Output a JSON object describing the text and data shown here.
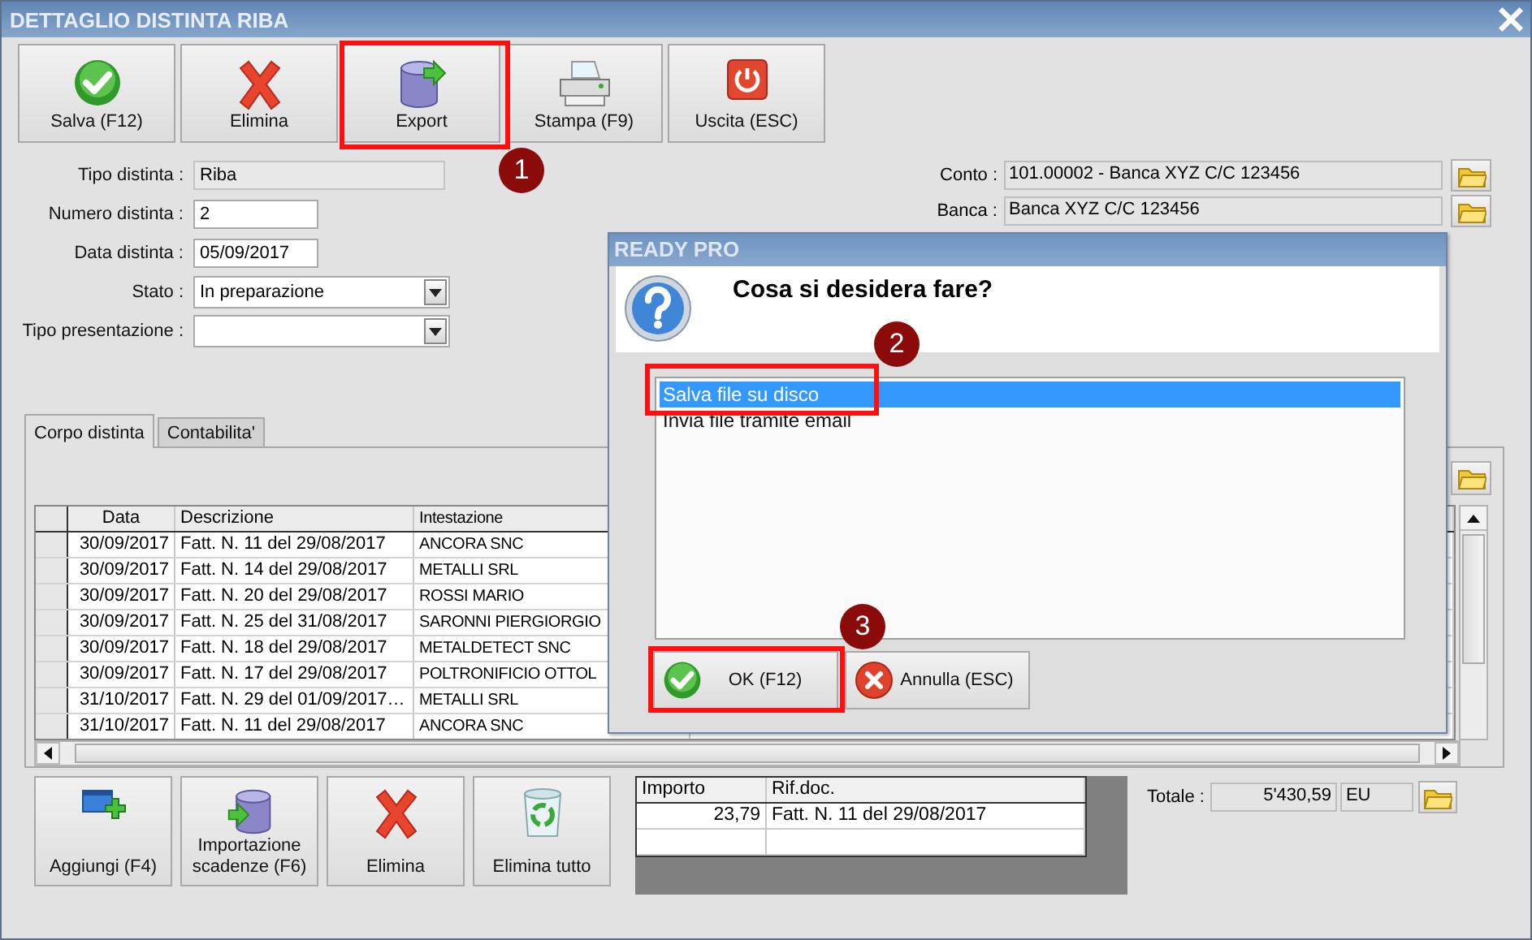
{
  "window": {
    "title": "DETTAGLIO DISTINTA RIBA"
  },
  "toolbar": [
    {
      "label": "Salva (F12)",
      "kind": "save"
    },
    {
      "label": "Elimina",
      "kind": "delete"
    },
    {
      "label": "Export",
      "kind": "export"
    },
    {
      "label": "Stampa (F9)",
      "kind": "print"
    },
    {
      "label": "Uscita (ESC)",
      "kind": "exit"
    }
  ],
  "form": [
    {
      "label": "Tipo distinta :",
      "value": "Riba",
      "kind": "readonly"
    },
    {
      "label": "Numero distinta :",
      "value": "2",
      "kind": "text"
    },
    {
      "label": "Data distinta :",
      "value": "05/09/2017",
      "kind": "text"
    },
    {
      "label": "Stato :",
      "value": "In preparazione",
      "kind": "dropdown"
    },
    {
      "label": "Tipo presentazione :",
      "kind": "dropdown"
    }
  ],
  "account": [
    {
      "label": "Conto :",
      "value": "101.00002 - Banca XYZ C/C 123456"
    },
    {
      "label": "Banca :",
      "value": "Banca XYZ C/C 123456"
    }
  ],
  "tabs": [
    {
      "label": "Corpo distinta",
      "selected": true
    },
    {
      "label": "Contabilita'",
      "selected": false
    }
  ],
  "table": {
    "columns": [
      "Data",
      "Descrizione",
      "Intestazione"
    ],
    "rows": [
      [
        "30/09/2017",
        "Fatt. N. 11 del 29/08/2017",
        "ANCORA SNC"
      ],
      [
        "30/09/2017",
        "Fatt. N. 14 del 29/08/2017",
        "METALLI SRL"
      ],
      [
        "30/09/2017",
        "Fatt. N. 20 del 29/08/2017",
        "ROSSI MARIO"
      ],
      [
        "30/09/2017",
        "Fatt. N. 25 del 31/08/2017",
        "SARONNI PIERGIORGIO"
      ],
      [
        "30/09/2017",
        "Fatt. N. 18 del 29/08/2017",
        "METALDETECT SNC"
      ],
      [
        "30/09/2017",
        "Fatt. N. 17 del 29/08/2017",
        "POLTRONIFICIO OTTOL"
      ],
      [
        "31/10/2017",
        "Fatt. N. 29 del 01/09/2017…",
        "METALLI SRL"
      ],
      [
        "31/10/2017",
        "Fatt. N. 11 del 29/08/2017",
        "ANCORA SNC"
      ]
    ]
  },
  "bottom_buttons": [
    {
      "label": "Aggiungi (F4)",
      "kind": "add"
    },
    {
      "label": "Importazione scadenze (F6)",
      "kind": "import"
    },
    {
      "label": "Elimina",
      "kind": "delete"
    },
    {
      "label": "Elimina tutto",
      "kind": "trash"
    }
  ],
  "detail_table": {
    "columns": [
      "Importo",
      "Rif.doc."
    ],
    "rows": [
      [
        "23,79",
        "Fatt. N. 11 del 29/08/2017"
      ]
    ]
  },
  "total": {
    "label": "Totale :",
    "value": "5'430,59",
    "currency": "EU"
  },
  "dialog": {
    "title": "READY PRO",
    "question": "Cosa si desidera fare?",
    "options": [
      {
        "label": "Salva file su disco",
        "selected": true
      },
      {
        "label": "Invia file tramite email",
        "selected": false
      }
    ],
    "buttons": [
      {
        "label": "OK (F12)",
        "kind": "ok"
      },
      {
        "label": "Annulla (ESC)",
        "kind": "cancel"
      }
    ]
  },
  "annotations": [
    {
      "number": "1"
    },
    {
      "number": "2"
    },
    {
      "number": "3"
    }
  ]
}
